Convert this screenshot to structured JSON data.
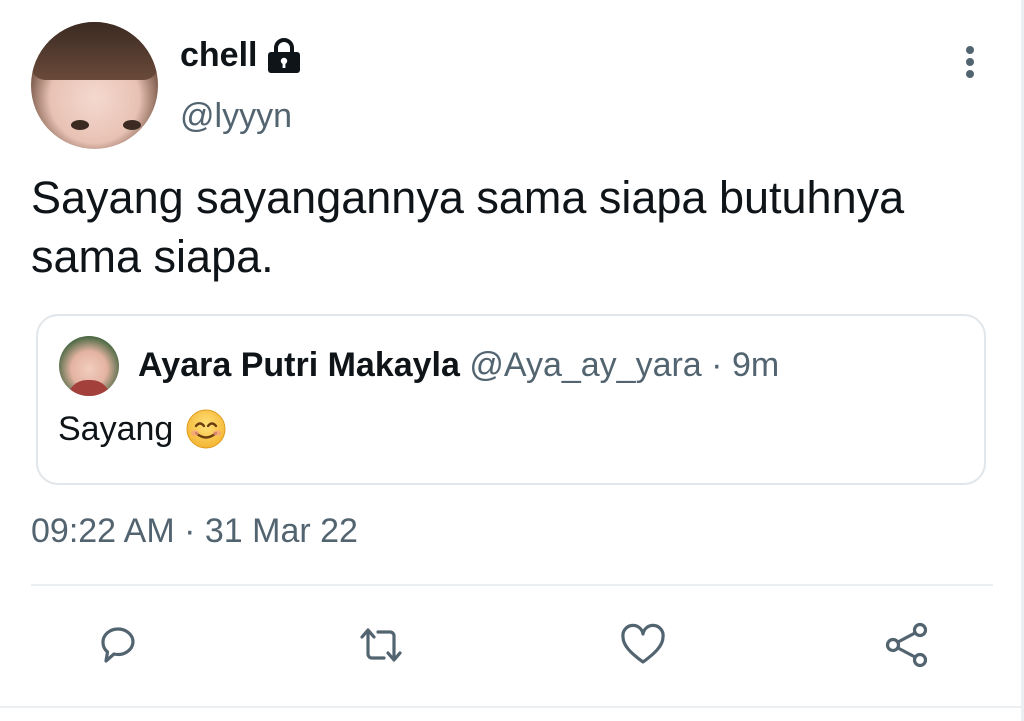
{
  "tweet": {
    "author": {
      "display_name": "chell",
      "handle": "@lyyyn",
      "protected_icon": "lock-icon"
    },
    "text": "Sayang sayangannya sama siapa butuhnya sama siapa.",
    "timestamp": "09:22 AM · 31 Mar 22"
  },
  "quoted_tweet": {
    "author": {
      "display_name": "Ayara Putri Makayla",
      "handle": "@Aya_ay_yara"
    },
    "separator": "·",
    "age": "9m",
    "text": "Sayang",
    "emoji": "smiling-face-icon"
  },
  "actions": [
    "reply-icon",
    "retweet-icon",
    "like-icon",
    "share-icon"
  ],
  "colors": {
    "text_primary": "#0f1419",
    "text_secondary": "#536471",
    "icon": "#536471",
    "border": "#e1e6ea"
  }
}
